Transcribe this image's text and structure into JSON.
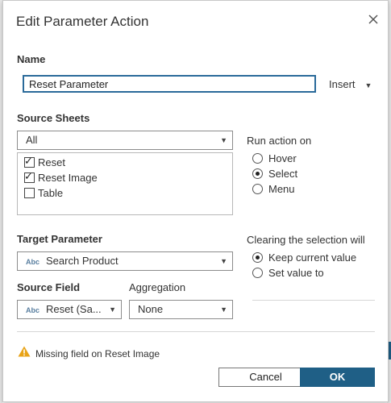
{
  "dialog": {
    "title": "Edit Parameter Action",
    "close_icon": "close-icon"
  },
  "name_section": {
    "label": "Name",
    "value": "Reset Parameter",
    "insert_label": "Insert"
  },
  "source_sheets": {
    "label": "Source Sheets",
    "selected": "All",
    "sheets": [
      {
        "label": "Reset",
        "checked": true
      },
      {
        "label": "Reset Image",
        "checked": true
      },
      {
        "label": "Table",
        "checked": false
      }
    ]
  },
  "run_action": {
    "label": "Run action on",
    "options": [
      {
        "label": "Hover",
        "selected": false
      },
      {
        "label": "Select",
        "selected": true
      },
      {
        "label": "Menu",
        "selected": false
      }
    ]
  },
  "target_parameter": {
    "label": "Target Parameter",
    "type_badge": "Abc",
    "value": "Search Product"
  },
  "clearing": {
    "label": "Clearing the selection will",
    "options": [
      {
        "label": "Keep current value",
        "selected": true
      },
      {
        "label": "Set value to",
        "selected": false
      }
    ]
  },
  "source_field": {
    "label": "Source Field",
    "type_badge": "Abc",
    "value": "Reset (Sa..."
  },
  "aggregation": {
    "label": "Aggregation",
    "value": "None"
  },
  "warning": {
    "text": "Missing field on Reset Image",
    "color": "#e8a317"
  },
  "buttons": {
    "cancel": "Cancel",
    "ok": "OK"
  },
  "colors": {
    "accent": "#1f5f86",
    "input_focus": "#2a6a9a"
  }
}
